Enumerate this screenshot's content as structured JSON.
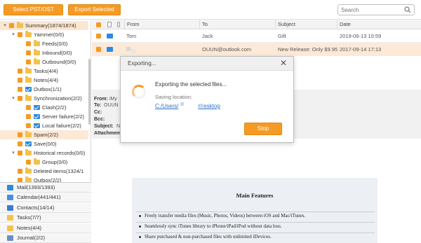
{
  "toolbar": {
    "select_label": "Select PST/OST",
    "export_label": "Export Selected",
    "search_placeholder": "Search"
  },
  "tree": [
    {
      "label": "Summary(1874/1874)",
      "level": 0,
      "arrow": "▾",
      "selected": true
    },
    {
      "label": "Yammer(0/0)",
      "level": 1,
      "arrow": "▾"
    },
    {
      "label": "Feeds(0/0)",
      "level": 2
    },
    {
      "label": "Inbound(0/0)",
      "level": 2
    },
    {
      "label": "Outbound(0/0)",
      "level": 2
    },
    {
      "label": "Tasks(4/4)",
      "level": 1
    },
    {
      "label": "Notes(4/4)",
      "level": 1
    },
    {
      "label": "Outbox(1/1)",
      "level": 1,
      "icon": "mail"
    },
    {
      "label": "Synchronization(2/2)",
      "level": 1,
      "arrow": "▾"
    },
    {
      "label": "Clash(2/2)",
      "level": 2,
      "icon": "mail"
    },
    {
      "label": "Server failure(2/2)",
      "level": 2,
      "icon": "mail"
    },
    {
      "label": "Local failure(2/2)",
      "level": 2,
      "icon": "mail"
    },
    {
      "label": "Spam(2/2)",
      "level": 1,
      "highlight": true
    },
    {
      "label": "Save(0/0)",
      "level": 1,
      "icon": "mail"
    },
    {
      "label": "Historical records(0/0)",
      "level": 1,
      "arrow": "▾"
    },
    {
      "label": "Group(0/0)",
      "level": 2
    },
    {
      "label": "Deleted items(1324/1",
      "level": 1
    },
    {
      "label": "Outbox(2/2)",
      "level": 1
    }
  ],
  "categories": [
    {
      "label": "Mail(1393/1393)",
      "color": "#2a8be0"
    },
    {
      "label": "Calendar(441/441)",
      "color": "#4a90d9"
    },
    {
      "label": "Contacts(14/14)",
      "color": "#3a7bd5"
    },
    {
      "label": "Tasks(7/7)",
      "color": "#f3c24c"
    },
    {
      "label": "Notes(4/4)",
      "color": "#f3c24c"
    },
    {
      "label": "Journal(2/2)",
      "color": "#6a8fc9"
    }
  ],
  "list": {
    "headers": {
      "from": "From",
      "to": "To",
      "subject": "Subject",
      "date": "Date"
    },
    "rows": [
      {
        "from": "Tom",
        "to": "Jack",
        "subject": "Gift",
        "date": "2019-06-13 10:59"
      },
      {
        "from": "",
        "to": "OUUN@outlook.com",
        "subject": "New Release: Only $9.95 to ...",
        "date": "2017-09-14 17:13"
      }
    ]
  },
  "preview": {
    "from_label": "From:",
    "from_value": "iMy",
    "to_label": "To:",
    "to_value": "OUUN",
    "cc_label": "Cc:",
    "bcc_label": "Bcc:",
    "subject_label": "Subject:",
    "subject_value": "N",
    "attach_label": "Attachment"
  },
  "email_body": {
    "title": "Main Features",
    "bullets": [
      "Freely transfer media files (Music, Photos, Videos) between iOS and Mac/iTunes.",
      "Seamlessly sync iTunes library to iPhone/iPad/iPod without data loss.",
      "Share purchased & non-purchased files with unlimited iDevices."
    ]
  },
  "dialog": {
    "title": "Exporting...",
    "message": "Exporting the selected files...",
    "location_label": "Saving location:",
    "path_start": "C:/Users/",
    "path_end": "/Desktop",
    "stop_label": "Stop"
  },
  "colors": {
    "accent": "#f59a23",
    "link": "#2a6fc9",
    "selection": "#fce9d7"
  }
}
